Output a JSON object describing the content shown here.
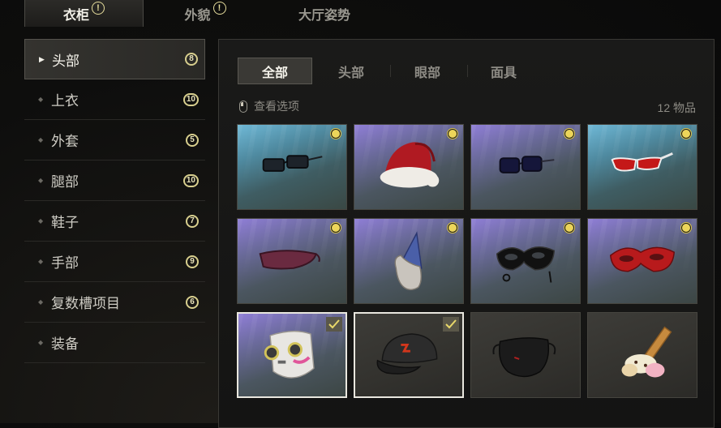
{
  "top_tabs": [
    {
      "label": "衣柜",
      "alert": "!"
    },
    {
      "label": "外貌",
      "alert": "!"
    },
    {
      "label": "大厅姿势"
    }
  ],
  "sidebar": {
    "items": [
      {
        "label": "头部",
        "badge": "8",
        "active": true
      },
      {
        "label": "上衣",
        "badge": "10"
      },
      {
        "label": "外套",
        "badge": "5"
      },
      {
        "label": "腿部",
        "badge": "10"
      },
      {
        "label": "鞋子",
        "badge": "7"
      },
      {
        "label": "手部",
        "badge": "9"
      },
      {
        "label": "复数槽项目",
        "badge": "6"
      },
      {
        "label": "装备"
      }
    ]
  },
  "category_tabs": [
    "全部",
    "头部",
    "眼部",
    "面具"
  ],
  "view_options_label": "查看选项",
  "item_count": "12 物品",
  "items": [
    {
      "icon": "black-glasses-icon",
      "bg": "blue",
      "new": true
    },
    {
      "icon": "santa-hat-icon",
      "bg": "purple",
      "new": true
    },
    {
      "icon": "dark-sunglasses-icon",
      "bg": "purple",
      "new": true
    },
    {
      "icon": "red-sport-sunglasses-icon",
      "bg": "blue",
      "new": true
    },
    {
      "icon": "visor-glasses-icon",
      "bg": "purple",
      "new": true
    },
    {
      "icon": "party-hat-wig-icon",
      "bg": "purple",
      "new": true
    },
    {
      "icon": "black-masquerade-mask-icon",
      "bg": "purple",
      "new": true
    },
    {
      "icon": "red-masquerade-mask-icon",
      "bg": "purple",
      "new": true
    },
    {
      "icon": "white-respirator-mask-icon",
      "bg": "purple",
      "equipped": true
    },
    {
      "icon": "black-cap-icon",
      "bg": "dark",
      "equipped": true
    },
    {
      "icon": "black-face-mask-icon",
      "bg": "dark"
    },
    {
      "icon": "ice-cream-hat-icon",
      "bg": "dark"
    }
  ],
  "colors": {
    "accent_badge": "#d8cf8e",
    "new_dot": "#ecd55a"
  }
}
